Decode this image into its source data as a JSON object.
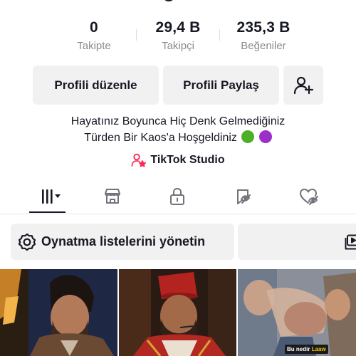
{
  "stats": [
    {
      "value": "0",
      "label": "Takipte"
    },
    {
      "value": "29,4 B",
      "label": "Takipçi"
    },
    {
      "value": "235,3 B",
      "label": "Beğeniler"
    }
  ],
  "actions": {
    "edit_profile": "Profili düzenle",
    "share_profile": "Profili Paylaş",
    "add_friend_icon": "person-plus-icon"
  },
  "bio": {
    "line1": "Hayatınız Boyunca Hiç Denk Gelmediğiniz",
    "line2": "Türden Bir Kaos'a Hoşgeldiniz",
    "emoji_colors": [
      "#4caf27",
      "#9b2fc9"
    ]
  },
  "studio": {
    "label": "TikTok Studio",
    "icon": "person-star-icon",
    "icon_color": "#fe2c55"
  },
  "tabs": [
    {
      "name": "videos",
      "icon": "grid-icon",
      "active": true
    },
    {
      "name": "shop",
      "icon": "shop-icon",
      "active": false
    },
    {
      "name": "private",
      "icon": "lock-icon",
      "active": false
    },
    {
      "name": "reposts",
      "icon": "repost-icon",
      "active": false
    },
    {
      "name": "liked",
      "icon": "liked-icon",
      "active": false
    }
  ],
  "playlists": {
    "manage_label": "Oynatma listelerini yönetin",
    "manage_icon": "gear-icon"
  },
  "videos": [
    {
      "thumbnail": "man-with-beard-on-stage"
    },
    {
      "thumbnail": "man-in-red-fez-with-headset"
    },
    {
      "thumbnail": "crowd-scene",
      "caption_prefix": "Bu nedir",
      "caption_highlight": "Laaw"
    }
  ],
  "colors": {
    "text": "#161823",
    "muted": "#8a8b91",
    "button_bg": "#f1f1f2",
    "accent": "#fe2c55",
    "caption_highlight": "#f7c300"
  }
}
